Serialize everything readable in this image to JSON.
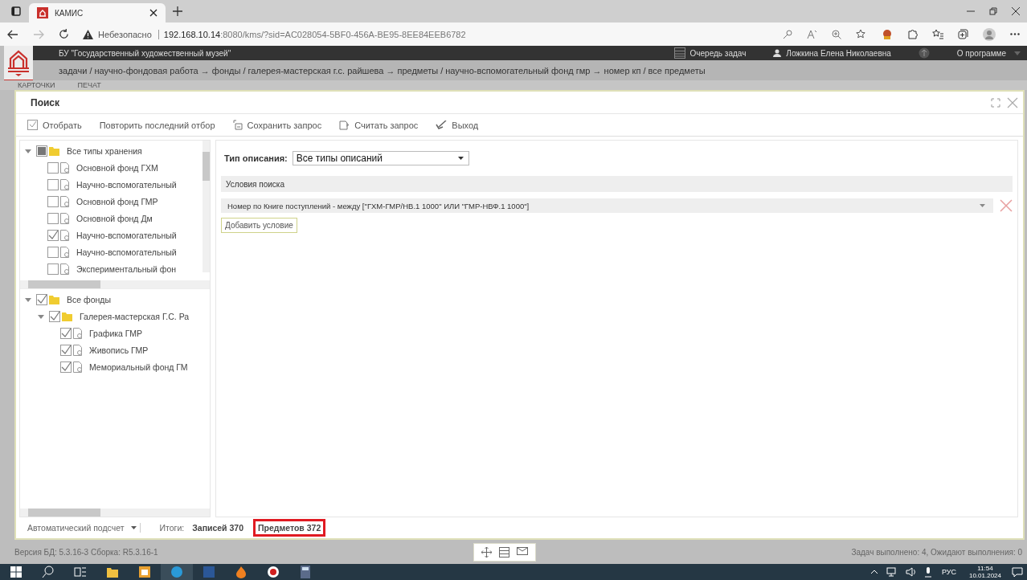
{
  "browser": {
    "tab_title": "КАМИС",
    "security": "Небезопасно",
    "host": "192.168.10.14",
    "path": ":8080/kms/?sid=AC028054-5BF0-456A-BE95-8EE84EEB6782"
  },
  "app": {
    "organization": "БУ \"Государственный художественный музей\"",
    "menu": [
      "Очередь задач",
      "Ложкина Елена Николаевна",
      "О программе"
    ],
    "breadcrumb": "задачи / научно-фондовая работа → фонды / галерея-мастерская г.с. райшева → предметы / научно-вспомогательный фонд гмр → номер кп / все предметы",
    "tabs": [
      "КАРТОЧКИ",
      "ПЕЧАТ"
    ]
  },
  "dialog": {
    "title": "Поиск",
    "toolbar": [
      "Отобрать",
      "Повторить последний отбор",
      "Сохранить запрос",
      "Считать запрос",
      "Выход"
    ],
    "storage_tree": [
      {
        "label": "Все типы хранения",
        "checked": false,
        "partial": true,
        "kind": "folder",
        "expanded": true,
        "children": [
          {
            "label": "Основной фонд ГХМ",
            "checked": false,
            "partial": false,
            "kind": "document"
          },
          {
            "label": "Научно-вспомогательный",
            "checked": false,
            "partial": false,
            "kind": "document"
          },
          {
            "label": "Основной фонд ГМР",
            "checked": false,
            "partial": false,
            "kind": "document"
          },
          {
            "label": "Основной фонд Дм",
            "checked": false,
            "partial": false,
            "kind": "document"
          },
          {
            "label": "Научно-вспомогательный",
            "checked": true,
            "partial": false,
            "kind": "document"
          },
          {
            "label": "Научно-вспомогательный",
            "checked": false,
            "partial": false,
            "kind": "document"
          },
          {
            "label": "Экспериментальный фон",
            "checked": false,
            "partial": false,
            "kind": "document"
          }
        ]
      }
    ],
    "fund_tree": [
      {
        "label": "Все фонды",
        "checked": true,
        "partial": false,
        "kind": "folder",
        "expanded": true,
        "children": [
          {
            "label": "Галерея-мастерская Г.С. Ра",
            "checked": true,
            "partial": false,
            "kind": "folder",
            "expanded": true,
            "children": [
              {
                "label": "Графика ГМР",
                "checked": true,
                "partial": false,
                "kind": "document"
              },
              {
                "label": "Живопись ГМР",
                "checked": true,
                "partial": false,
                "kind": "document"
              },
              {
                "label": "Мемориальный фонд ГМ",
                "checked": true,
                "partial": false,
                "kind": "document"
              }
            ]
          }
        ]
      }
    ],
    "description_type": {
      "label": "Тип описания:",
      "value": "Все типы описаний"
    },
    "conditions": {
      "header": "Условия поиска",
      "items": [
        "Номер по Книге поступлений - между [\"ГХМ-ГМР/НВ.1 1000\" ИЛИ \"ГМР-НВФ.1 1000\"]"
      ],
      "add_button": "Добавить условие"
    },
    "footer": {
      "count_mode": "Автоматический подсчет",
      "totals_label": "Итоги:",
      "totals": [
        {
          "text": "Записей 370",
          "highlighted": false
        },
        {
          "text": "Предметов 372",
          "highlighted": true
        }
      ]
    }
  },
  "status_bar": {
    "version": "Версия БД: 5.3.16-3 Сборка: R5.3.16-1",
    "tasks": "Задач выполнено: 4, Ожидают выполнения: 0"
  },
  "taskbar": {
    "language": "РУС",
    "time": "11:54",
    "date": "10.01.2024"
  }
}
